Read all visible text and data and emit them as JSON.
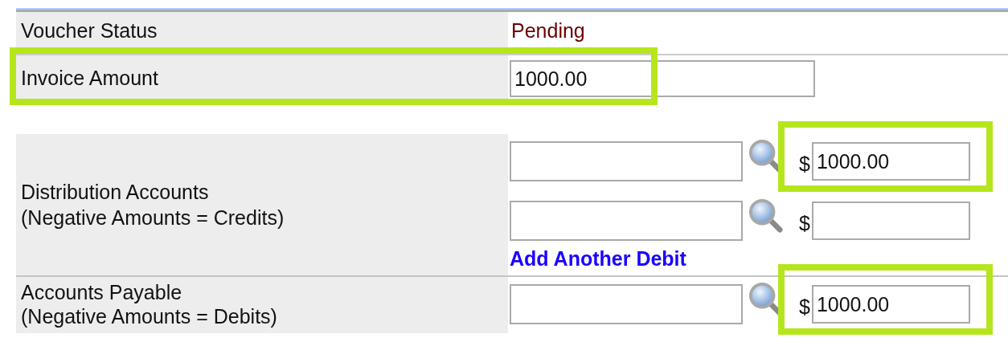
{
  "status": {
    "label": "Voucher Status",
    "value": "Pending"
  },
  "invoice": {
    "label": "Invoice Amount",
    "value": "1000.00",
    "highlighted": true
  },
  "distribution": {
    "label": "Distribution Accounts\n(Negative Amounts = Credits)",
    "lines": [
      {
        "currency": "$",
        "amount": "1000.00",
        "highlighted": true
      },
      {
        "currency": "$",
        "highlighted": false
      }
    ],
    "add_link": "Add Another Debit"
  },
  "payable": {
    "label": "Accounts Payable\n(Negative Amounts = Debits)",
    "lines": [
      {
        "currency": "$",
        "amount": "1000.00",
        "highlighted": true
      }
    ]
  }
}
